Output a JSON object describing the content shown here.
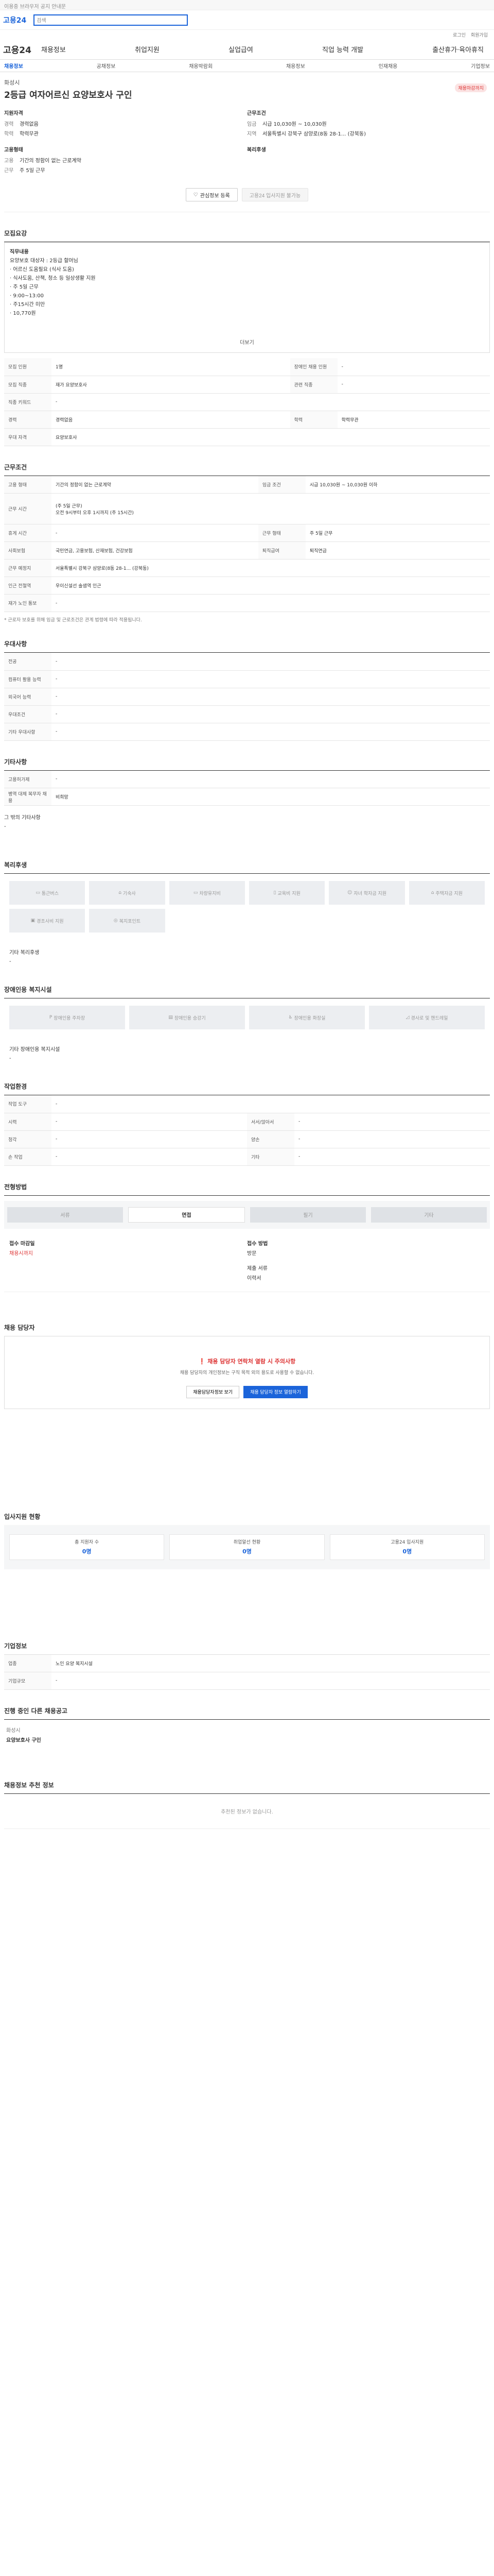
{
  "notice": "이용중 브라우저 공지 안내문",
  "topbar": {
    "logo": "고용24",
    "search_placeholder": "검색"
  },
  "util": [
    "로그인",
    "회원가입"
  ],
  "gnb": {
    "brand": "고용24",
    "menu": [
      "채용정보",
      "취업지원",
      "실업급여",
      "직업 능력 개발",
      "출산휴가·육아휴직"
    ]
  },
  "lnb": [
    "채용정보",
    "공채정보",
    "채용박람회",
    "채용정보",
    "인재채용",
    "기업정보"
  ],
  "job": {
    "company": "화성시",
    "title": "2등급 여자어르신 요양보호사 구인",
    "dday": "채용마감까지",
    "left_title": "지원자격",
    "left": [
      {
        "k": "경력",
        "v": "경력없음"
      },
      {
        "k": "학력",
        "v": "학력무관"
      }
    ],
    "left_title2": "고용형태",
    "left2": [
      {
        "k": "고용",
        "v": "기간의 정함이 없는 근로계약"
      },
      {
        "k": "근무",
        "v": "주 5일 근무"
      }
    ],
    "right_title": "근무조건",
    "right": [
      {
        "k": "임금",
        "v": "시급 10,030원 ~ 10,030원"
      },
      {
        "k": "지역",
        "v": "서울특별시 강북구 삼양로(8동 28-1... (강북동)"
      }
    ],
    "right_title2": "복리후생",
    "btn_like": "관심정보 등록",
    "btn_apply": "고용24 입사지원 불가능"
  },
  "sections": {
    "content": {
      "title": "모집요강",
      "body": [
        "직무내용",
        "요양보호 대상자 : 2등급 할머님",
        "· 어르신 도움필요 (식사 도움)",
        "· 식사도움, 산책, 청소 등 일상생활 지원",
        "· 주 5일 근무",
        "· 9:00~13:00",
        "· 주15시간 미만",
        "· 10,770원"
      ],
      "more": "더보기"
    },
    "recruit": {
      "rows": [
        [
          "모집 인원",
          "1명",
          "장애인 채용 인원",
          "-"
        ],
        [
          "모집 직종",
          "재가 요양보호사",
          "관련 직종",
          "-"
        ],
        [
          "직종 키워드",
          "-",
          "",
          ""
        ],
        [
          "경력",
          "경력없음",
          "학력",
          "학력무관"
        ],
        [
          "우대 자격",
          "요양보호사",
          "",
          ""
        ]
      ]
    },
    "conditions": {
      "title": "근무조건",
      "rows": [
        [
          "고용 형태",
          "기간의 정함이 없는 근로계약",
          "임금 조건",
          "시급 10,030원 ~ 10,030원 이하"
        ],
        [
          "근무 시간",
          "(주 5일 근무)\n오전 9시부터 오후 1시까지 (주 15시간)",
          "",
          ""
        ],
        [
          "휴게 시간",
          "-",
          "근무 형태",
          "주 5일 근무"
        ],
        [
          "사회보험",
          "국민연금, 고용보험, 산재보험, 건강보험",
          "퇴직급여",
          "퇴직연금"
        ],
        [
          "근무 예정지",
          "서울특별시 강북구 삼양로(8동 28-1... (강북동)",
          "",
          ""
        ],
        [
          "인근 전철역",
          "우이신설선 솔샘역 인근",
          "",
          ""
        ],
        [
          "재가 노인 통보",
          "-",
          "",
          ""
        ]
      ],
      "note": "* 근로자 보호를 위해 임금 및 근로조건은 관계 법령에 따라 적용됩니다."
    },
    "pref": {
      "title": "우대사항",
      "rows": [
        [
          "전공",
          "-"
        ],
        [
          "컴퓨터 활용 능력",
          "-"
        ],
        [
          "외국어 능력",
          "-"
        ],
        [
          "우대조건",
          "-"
        ],
        [
          "기타 우대사항",
          "-"
        ]
      ]
    },
    "other": {
      "title": "기타사항",
      "rows": [
        [
          "고용허가제",
          "-"
        ],
        [
          "병역 대체 복무자 채용",
          "비희망"
        ]
      ],
      "extra_title": "그 밖의 기타사항",
      "extra": "-"
    },
    "welfare": {
      "title": "복리후생",
      "items": [
        "통근버스",
        "기숙사",
        "차량유지비",
        "교육비 지원",
        "자녀 학자금 지원",
        "주택자금 지원",
        "경조사비 지원",
        "복지포인트"
      ],
      "other_label": "기타 복리후생",
      "other_value": "-"
    },
    "disability": {
      "title": "장애인용 복지시설",
      "items": [
        "장애인용 주차장",
        "장애인용 승강기",
        "장애인용 화장실",
        "경사로 및 핸드레일"
      ],
      "other_label": "기타 장애인용 복지시설",
      "other_value": "-"
    },
    "workenv": {
      "title": "작업환경",
      "rows": [
        [
          "작업 도구",
          "-",
          "",
          ""
        ],
        [
          "시력",
          "-",
          "서서/앉아서",
          "-"
        ],
        [
          "청각",
          "-",
          "양손",
          "-"
        ],
        [
          "손 작업",
          "-",
          "기타",
          "-"
        ]
      ]
    },
    "process": {
      "title": "전형방법",
      "steps": [
        "서류",
        "면접",
        "필기",
        "기타"
      ],
      "left_label": "접수 마감일",
      "left_value": "채용시까지",
      "right_label": "접수 방법",
      "right_value": "방문",
      "doc_label": "제출 서류",
      "doc_value": "이력서"
    },
    "contact": {
      "title": "채용 담당자",
      "warn": "채용 담당자 연락처 열람 시 주의사항",
      "desc": "채용 담당자의 개인정보는 구직 목적 외의 용도로 사용할 수 없습니다.",
      "btn1": "채용담당자정보 보기",
      "btn2": "채용 담당자 정보 열람하기"
    },
    "apply_stats": {
      "title": "입사지원 현황",
      "items": [
        {
          "label": "총 지원자 수",
          "value": "0명"
        },
        {
          "label": "취업알선 현황",
          "value": "0명"
        },
        {
          "label": "고용24 입사지원",
          "value": "0명"
        }
      ]
    },
    "company_info": {
      "title": "기업정보",
      "rows": [
        [
          "업종",
          "노인 요양 복지시설"
        ],
        [
          "기업규모",
          "-"
        ]
      ]
    },
    "related": {
      "title": "진행 중인 다른 채용공고",
      "company": "화성시",
      "job": "요양보호사 구인"
    },
    "recommend": {
      "title": "채용정보 추천 정보",
      "empty": "추천된 정보가 없습니다."
    }
  }
}
